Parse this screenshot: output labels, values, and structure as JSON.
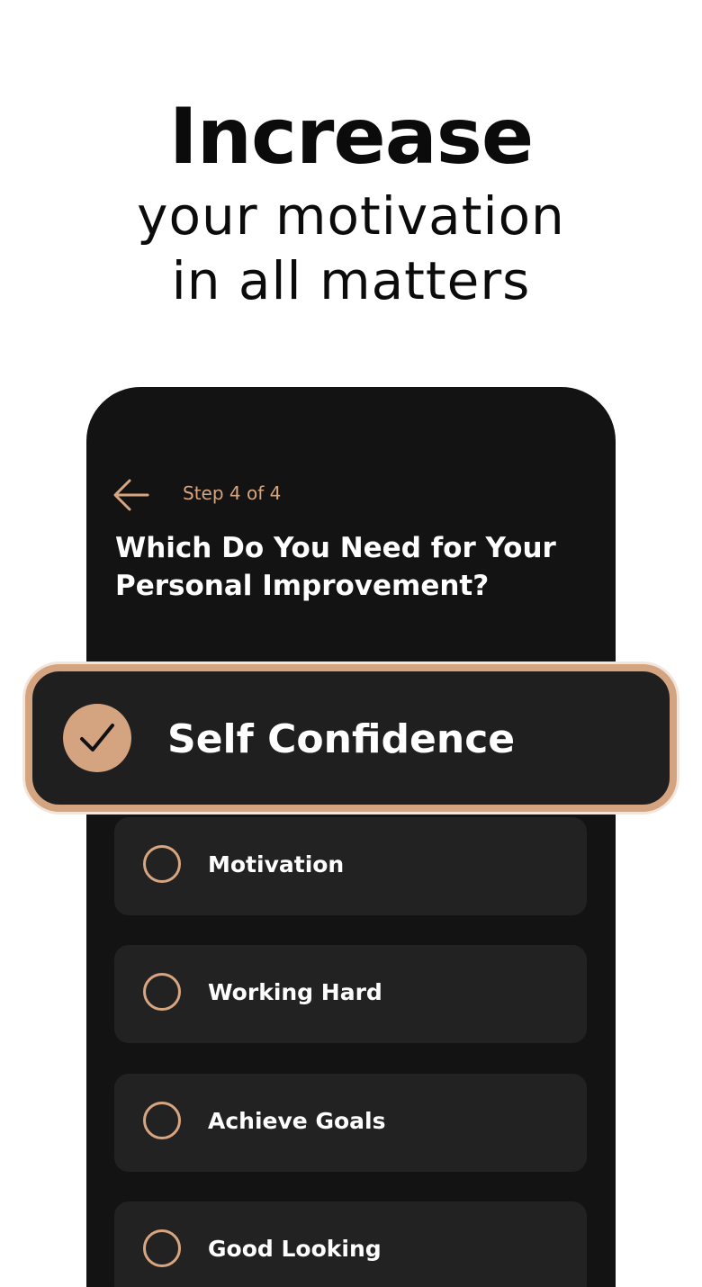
{
  "headline": {
    "title": "Increase",
    "subtitle_line1": "your motivation",
    "subtitle_line2": "in all matters"
  },
  "screen": {
    "step_label": "Step 4 of 4",
    "question": "Which Do You Need for Your Personal Improvement?",
    "selected_option": {
      "label": "Self Confidence",
      "checked": true
    },
    "options": [
      {
        "label": "Motivation",
        "checked": false
      },
      {
        "label": "Working Hard",
        "checked": false
      },
      {
        "label": "Achieve Goals",
        "checked": false
      },
      {
        "label": "Good Looking",
        "checked": false
      }
    ]
  },
  "colors": {
    "accent": "#d4a37f",
    "phone_background": "#131313",
    "option_background": "#222222",
    "text_on_dark": "#ffffff",
    "headline_text": "#0b0b0b"
  },
  "icons": {
    "back": "arrow-left-icon",
    "check": "checkmark-icon",
    "radio": "radio-empty-icon"
  }
}
